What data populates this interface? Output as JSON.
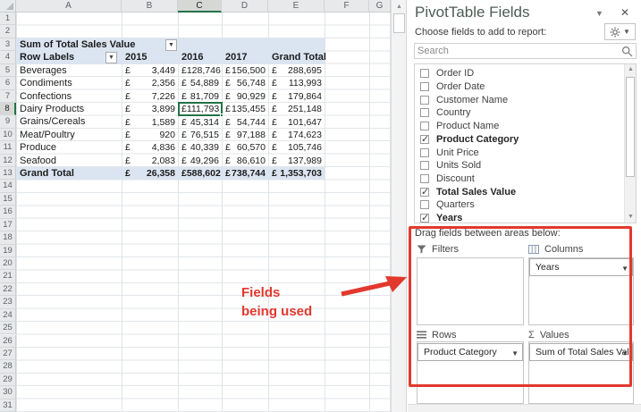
{
  "sheet": {
    "column_letters": [
      "A",
      "B",
      "C",
      "D",
      "E",
      "F",
      "G"
    ],
    "visible_row_count": 31,
    "selected_column": "C",
    "selected_row_number": 8,
    "pivot": {
      "title_cell": "Sum of Total Sales Value",
      "row_labels_header": "Row Labels",
      "currency": "£",
      "col_headers": [
        "2015",
        "2016",
        "2017",
        "Grand Total"
      ],
      "rows": [
        {
          "label": "Beverages",
          "values": [
            "3,449",
            "128,746",
            "156,500",
            "288,695"
          ],
          "bold": false
        },
        {
          "label": "Condiments",
          "values": [
            "2,356",
            "54,889",
            "56,748",
            "113,993"
          ],
          "bold": false
        },
        {
          "label": "Confections",
          "values": [
            "7,226",
            "81,709",
            "90,929",
            "179,864"
          ],
          "bold": false
        },
        {
          "label": "Dairy Products",
          "values": [
            "3,899",
            "111,793",
            "135,455",
            "251,148"
          ],
          "bold": false
        },
        {
          "label": "Grains/Cereals",
          "values": [
            "1,589",
            "45,314",
            "54,744",
            "101,647"
          ],
          "bold": false
        },
        {
          "label": "Meat/Poultry",
          "values": [
            "920",
            "76,515",
            "97,188",
            "174,623"
          ],
          "bold": false
        },
        {
          "label": "Produce",
          "values": [
            "4,836",
            "40,339",
            "60,570",
            "105,746"
          ],
          "bold": false
        },
        {
          "label": "Seafood",
          "values": [
            "2,083",
            "49,296",
            "86,610",
            "137,989"
          ],
          "bold": false
        },
        {
          "label": "Grand Total",
          "values": [
            "26,358",
            "588,602",
            "738,744",
            "1,353,703"
          ],
          "bold": true
        }
      ],
      "selected_cell": {
        "column": "2016",
        "row": "Dairy Products",
        "value": "111,793"
      }
    }
  },
  "panel": {
    "title": "PivotTable Fields",
    "choose_label": "Choose fields to add to report:",
    "search_placeholder": "Search",
    "fields": [
      {
        "label": "Order ID",
        "checked": false
      },
      {
        "label": "Order Date",
        "checked": false
      },
      {
        "label": "Customer Name",
        "checked": false
      },
      {
        "label": "Country",
        "checked": false
      },
      {
        "label": "Product Name",
        "checked": false
      },
      {
        "label": "Product Category",
        "checked": true
      },
      {
        "label": "Unit Price",
        "checked": false
      },
      {
        "label": "Units Sold",
        "checked": false
      },
      {
        "label": "Discount",
        "checked": false
      },
      {
        "label": "Total Sales Value",
        "checked": true
      },
      {
        "label": "Quarters",
        "checked": false
      },
      {
        "label": "Years",
        "checked": true
      }
    ],
    "drag_label": "Drag fields between areas below:",
    "areas": {
      "filters": {
        "label": "Filters",
        "items": []
      },
      "columns": {
        "label": "Columns",
        "items": [
          "Years"
        ]
      },
      "rows": {
        "label": "Rows",
        "items": [
          "Product Category"
        ]
      },
      "values": {
        "label": "Values",
        "items": [
          "Sum of Total Sales Value"
        ]
      }
    }
  },
  "annotation": {
    "line1": "Fields",
    "line2": "being used",
    "color": "#e2382d"
  },
  "colors": {
    "pivot_header_fill": "#dbe5f1",
    "selection_green": "#217346",
    "annotation_red": "#e2382d",
    "header_gray": "#e8e9ea"
  }
}
